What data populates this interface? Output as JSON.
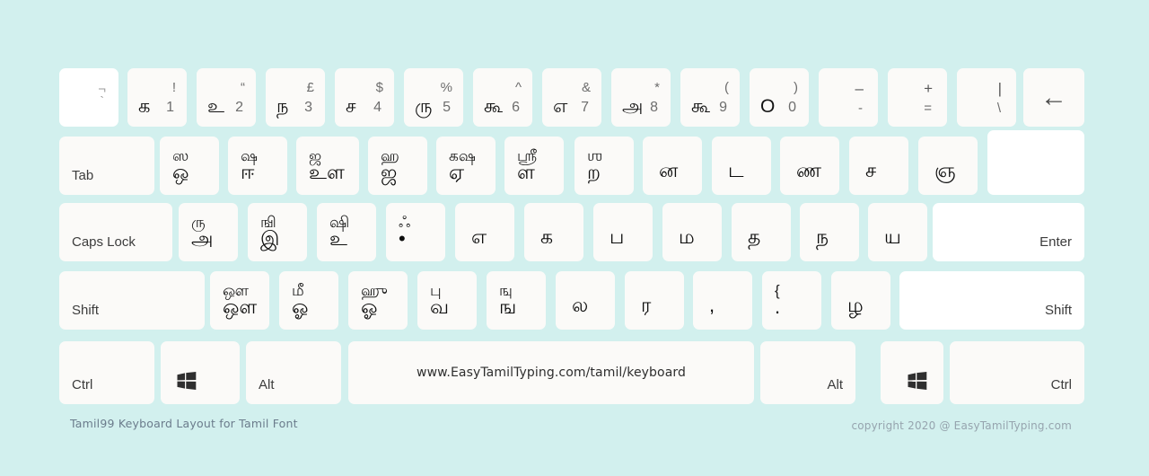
{
  "meta": {
    "title": "Tamil99 Keyboard Layout for Tamil Font",
    "background_color": "#d2f0ee",
    "key_color": "#fbfaf8"
  },
  "footer": {
    "left": "Tamil99 Keyboard Layout for Tamil Font",
    "right": "copyright 2020 @ EasyTamilTyping.com"
  },
  "spacebar": {
    "label": "www.EasyTamilTyping.com/tamil/keyboard"
  },
  "row_number": {
    "tilde_key": {
      "top": "¬",
      "bottom": "`"
    },
    "keys": [
      {
        "symbol": "!",
        "tamil": "க",
        "digit": "1"
      },
      {
        "symbol": "“",
        "tamil": "உ",
        "digit": "2"
      },
      {
        "symbol": "£",
        "tamil": "ந",
        "digit": "3"
      },
      {
        "symbol": "$",
        "tamil": "ச",
        "digit": "4"
      },
      {
        "symbol": "%",
        "tamil": "ரு",
        "digit": "5"
      },
      {
        "symbol": "^",
        "tamil": "கூ",
        "digit": "6"
      },
      {
        "symbol": "&",
        "tamil": "எ",
        "digit": "7"
      },
      {
        "symbol": "*",
        "tamil": "அ",
        "digit": "8"
      },
      {
        "symbol": "(",
        "tamil": "கூ",
        "digit": "9"
      },
      {
        "symbol": ")",
        "tamil": "O",
        "digit": "0"
      }
    ],
    "minus_key": {
      "top": "–",
      "bottom": "-"
    },
    "equal_key": {
      "top": "+",
      "bottom": "="
    },
    "pipe_key": {
      "top": "|",
      "bottom": "\\"
    },
    "backspace": {
      "glyph": "←",
      "name": "Backspace"
    }
  },
  "row_tab": {
    "tab_label": "Tab",
    "keys": [
      {
        "top": "ஸ",
        "bottom": "ஒ"
      },
      {
        "top": "ஷ",
        "bottom": "ஈ"
      },
      {
        "top": "ஜ",
        "bottom": "உள"
      },
      {
        "top": "ஹ",
        "bottom": "ஜ"
      },
      {
        "top": "கஷ",
        "bottom": "ஏ"
      },
      {
        "top": "ஸ்ரீ",
        "bottom": "ள"
      },
      {
        "top": "ஶ",
        "bottom": "ற"
      },
      {
        "top": "",
        "bottom": "ன"
      },
      {
        "top": "",
        "bottom": "ட"
      },
      {
        "top": "",
        "bottom": "ண"
      },
      {
        "top": "",
        "bottom": "ச"
      },
      {
        "top": "",
        "bottom": "ஞ"
      }
    ]
  },
  "row_home": {
    "capslock_label": "Caps Lock",
    "enter_label": "Enter",
    "keys": [
      {
        "top": "ரு",
        "bottom": "அ"
      },
      {
        "top": "ஙி",
        "bottom": "இ"
      },
      {
        "top": "ஷி",
        "bottom": "உ"
      },
      {
        "top": "ஃ",
        "bottom": "•"
      },
      {
        "top": "",
        "bottom": "எ"
      },
      {
        "top": "",
        "bottom": "க"
      },
      {
        "top": "",
        "bottom": "ப"
      },
      {
        "top": "",
        "bottom": "ம"
      },
      {
        "top": "",
        "bottom": "த"
      },
      {
        "top": "",
        "bottom": "ந"
      },
      {
        "top": "",
        "bottom": "ய"
      }
    ]
  },
  "row_shift": {
    "shift_left_label": "Shift",
    "shift_right_label": "Shift",
    "keys": [
      {
        "top": "ஔ",
        "bottom": "ஒள"
      },
      {
        "top": "மீ",
        "bottom": "ஓ"
      },
      {
        "top": "ஹு",
        "bottom": "ஓ"
      },
      {
        "top": "பு",
        "bottom": "வ"
      },
      {
        "top": "ஙு",
        "bottom": "ங"
      },
      {
        "top": "",
        "bottom": "ல"
      },
      {
        "top": "",
        "bottom": "ர"
      },
      {
        "top": "",
        "bottom": ","
      },
      {
        "top": "{",
        "bottom": "."
      },
      {
        "top": "",
        "bottom": "ழ"
      }
    ]
  },
  "row_bottom": {
    "ctrl_left": "Ctrl",
    "win_left": "windows-logo",
    "alt_left": "Alt",
    "alt_right": "Alt",
    "win_right": "windows-logo",
    "ctrl_right": "Ctrl"
  }
}
